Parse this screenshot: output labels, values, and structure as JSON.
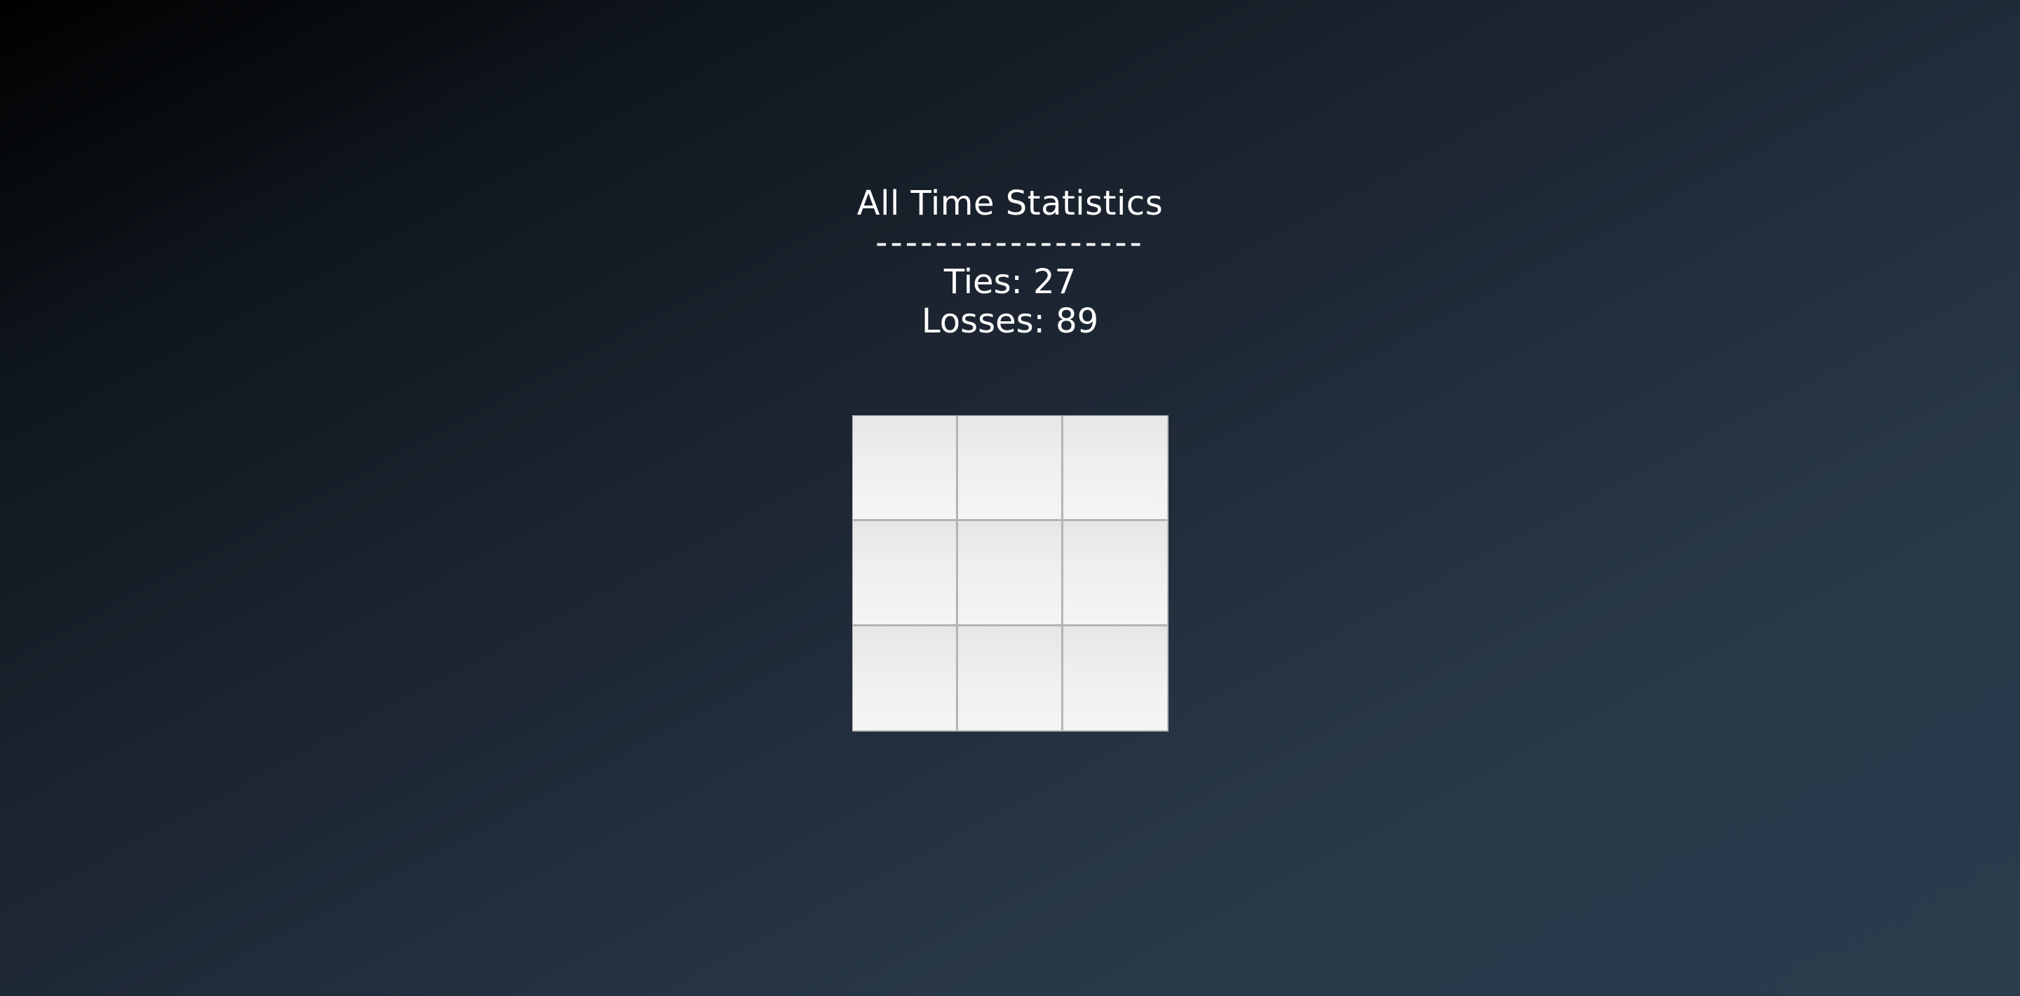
{
  "stats": {
    "title": "All Time Statistics",
    "divider": "------------------",
    "ties": "Ties: 27",
    "losses": "Losses: 89"
  },
  "board": {
    "cells": [
      "",
      "",
      "",
      "",
      "",
      "",
      "",
      "",
      ""
    ]
  },
  "colors": {
    "background_dark": "#000000",
    "background_light": "#2b3b4c",
    "cell_fill": "#efefef",
    "cell_border": "#b4b4b4",
    "text": "#ffffff"
  }
}
